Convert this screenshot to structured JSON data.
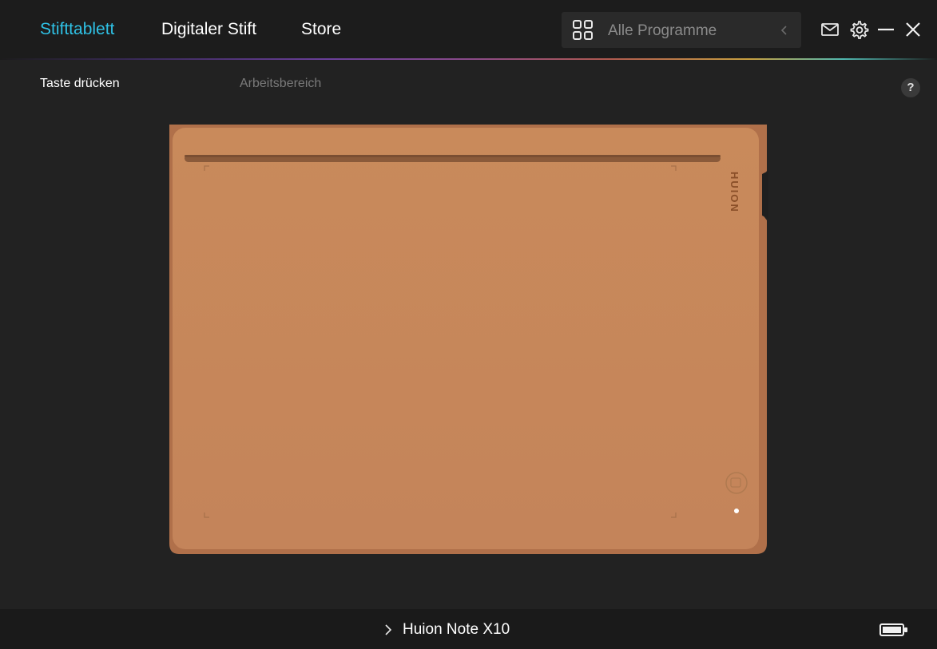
{
  "nav": {
    "tabs": [
      {
        "label": "Stifttablett",
        "active": true
      },
      {
        "label": "Digitaler Stift",
        "active": false
      },
      {
        "label": "Store",
        "active": false
      }
    ]
  },
  "program_select": {
    "icon": "grid-icon",
    "selected": "Alle Programme"
  },
  "window_controls": {
    "icons": [
      "mail-icon",
      "gear-icon",
      "minimize-icon",
      "close-icon"
    ]
  },
  "subtabs": [
    {
      "label": "Taste drücken",
      "active": true
    },
    {
      "label": "Arbeitsbereich",
      "active": false
    }
  ],
  "help": {
    "label": "?"
  },
  "tablet": {
    "brand": "HUION",
    "color": "#c98a5b"
  },
  "footer": {
    "device_name": "Huion Note X10",
    "battery_icon": "battery-icon"
  },
  "colors": {
    "accent": "#2fc2e6",
    "background": "#222222",
    "titlebar": "#1c1c1c"
  }
}
